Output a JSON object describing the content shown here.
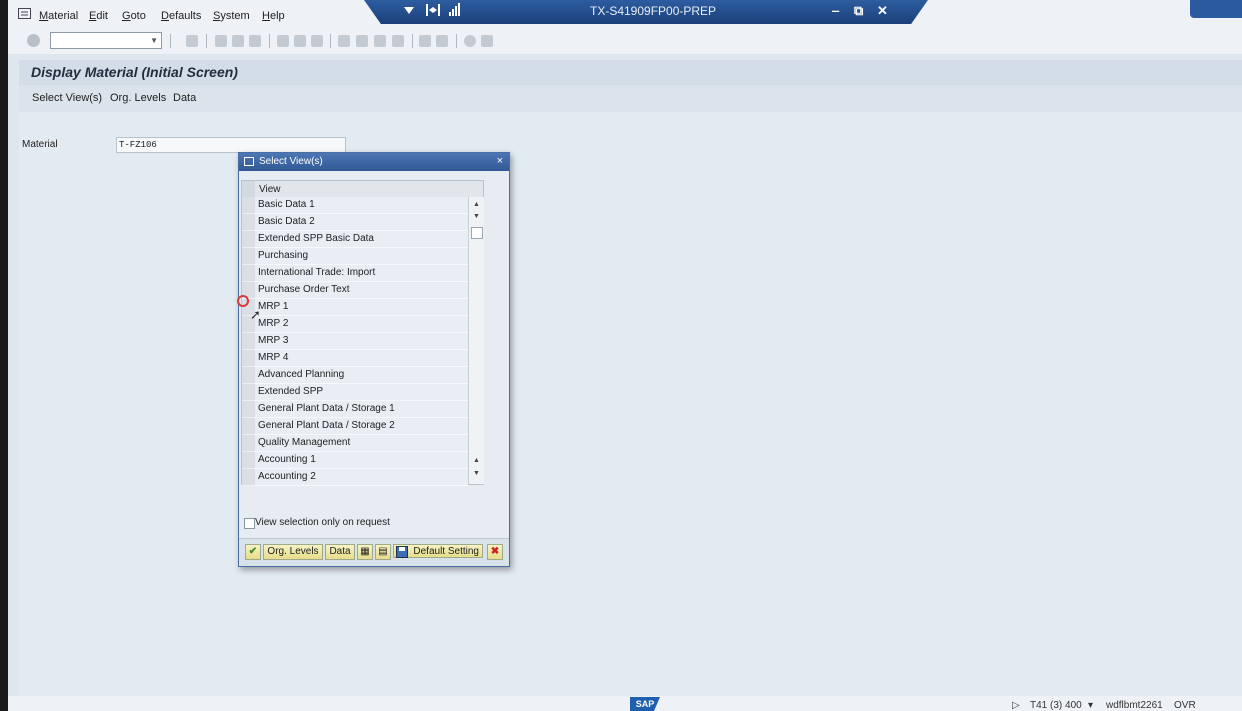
{
  "menubar": {
    "items": [
      {
        "ul": "M",
        "rest": "aterial"
      },
      {
        "ul": "E",
        "rest": "dit"
      },
      {
        "ul": "G",
        "rest": "oto"
      },
      {
        "ul": "D",
        "rest": "efaults"
      },
      {
        "ul": "S",
        "rest": "ystem"
      },
      {
        "ul": "H",
        "rest": "elp"
      }
    ]
  },
  "window": {
    "title": "TX-S41909FP00-PREP",
    "minimize": "‒",
    "restore": "⧉",
    "close": "✕"
  },
  "toolbar": {
    "command_field_value": "",
    "dropdown_arrow": "▼"
  },
  "screen": {
    "title": "Display Material (Initial Screen)",
    "buttons": [
      "Select View(s)",
      "Org. Levels",
      "Data"
    ]
  },
  "form": {
    "material_label": "Material",
    "material_value": "T-FZ106"
  },
  "dialog": {
    "title": "Select View(s)",
    "close": "×",
    "column_header": "View",
    "views": [
      "Basic Data 1",
      "Basic Data 2",
      "Extended SPP Basic Data",
      "Purchasing",
      "International Trade: Import",
      "Purchase Order Text",
      "MRP 1",
      "MRP 2",
      "MRP 3",
      "MRP 4",
      "Advanced Planning",
      "Extended SPP",
      "General Plant Data / Storage 1",
      "General Plant Data / Storage 2",
      "Quality Management",
      "Accounting 1",
      "Accounting 2"
    ],
    "checkbox_label": "View selection only on request",
    "footer": {
      "ok": "✔",
      "org_levels": "Org. Levels",
      "data": "Data",
      "default_setting": "Default Setting",
      "cancel": "✖"
    }
  },
  "status": {
    "sap_logo": "SAP",
    "system": "T41 (3) 400",
    "dropdown": "▾",
    "server": "wdflbmt2261",
    "mode": "OVR",
    "play": "▷"
  },
  "colors": {
    "title_bar": "#1b3f7a",
    "dialog_title": "#2f5894",
    "background": "#dfe7ee",
    "button_yellow": "#e6dd8a",
    "cancel_red": "#cc2222",
    "ok_green": "#3b8c2a"
  }
}
